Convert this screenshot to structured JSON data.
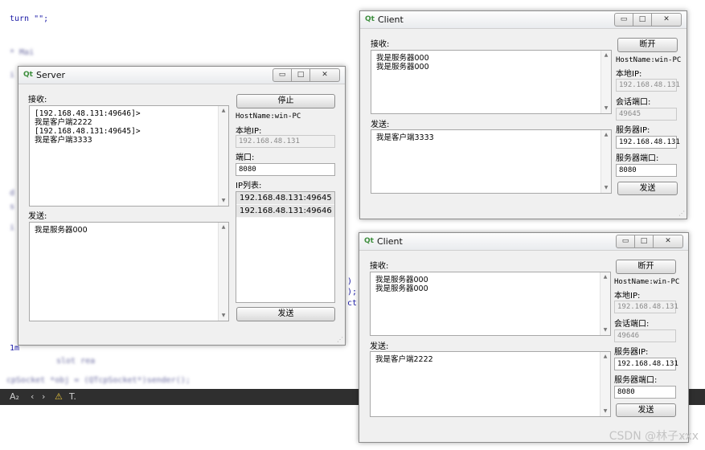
{
  "editor": {
    "lines": [
      "turn \"\";",
      "* Mai",
      "i",
      "d",
      "s",
      "i",
      ")",
      ");",
      "ct",
      "1m",
      "slot rea",
      "cpSocket *obj = (QTcpSocket*)sender();"
    ],
    "taskbar_glyph": "A₂",
    "taskbar_warning": "⚠",
    "taskbar_filter": "T.",
    "watermark": "CSDN @林子xxx"
  },
  "server": {
    "title": "Server",
    "recv_label": "接收:",
    "recv_lines": [
      "[192.168.48.131:49646]>",
      "我是客户端2222",
      "[192.168.48.131:49645]>",
      "我是客户端3333"
    ],
    "send_label": "发送:",
    "send_text": "我是服务器000",
    "stop_button": "停止",
    "hostname": "HostName:win-PC",
    "local_ip_label": "本地IP:",
    "local_ip_value": "192.168.48.131",
    "port_label": "端口:",
    "port_value": "8080",
    "iplist_label": "IP列表:",
    "ip_list": [
      "192.168.48.131:49645",
      "192.168.48.131:49646"
    ],
    "send_button": "发送"
  },
  "client1": {
    "title": "Client",
    "recv_label": "接收:",
    "recv_lines": [
      "我是服务器000",
      "我是服务器000"
    ],
    "send_label": "发送:",
    "send_text": "我是客户端3333",
    "disconnect_button": "断开",
    "hostname": "HostName:win-PC",
    "local_ip_label": "本地IP:",
    "local_ip_value": "192.168.48.131",
    "session_port_label": "会话端口:",
    "session_port_value": "49645",
    "server_ip_label": "服务器IP:",
    "server_ip_value": "192.168.48.131",
    "server_port_label": "服务器端口:",
    "server_port_value": "8080",
    "send_button": "发送"
  },
  "client2": {
    "title": "Client",
    "recv_label": "接收:",
    "recv_lines": [
      "我是服务器000",
      "我是服务器000"
    ],
    "send_label": "发送:",
    "send_text": "我是客户端2222",
    "disconnect_button": "断开",
    "hostname": "HostName:win-PC",
    "local_ip_label": "本地IP:",
    "local_ip_value": "192.168.48.131",
    "session_port_label": "会话端口:",
    "session_port_value": "49646",
    "server_ip_label": "服务器IP:",
    "server_ip_value": "192.168.48.131",
    "server_port_label": "服务器端口:",
    "server_port_value": "8080",
    "send_button": "发送"
  },
  "window_buttons": {
    "minimize": "▭",
    "maximize": "□",
    "close": "✕"
  },
  "app_logo": "Qt"
}
